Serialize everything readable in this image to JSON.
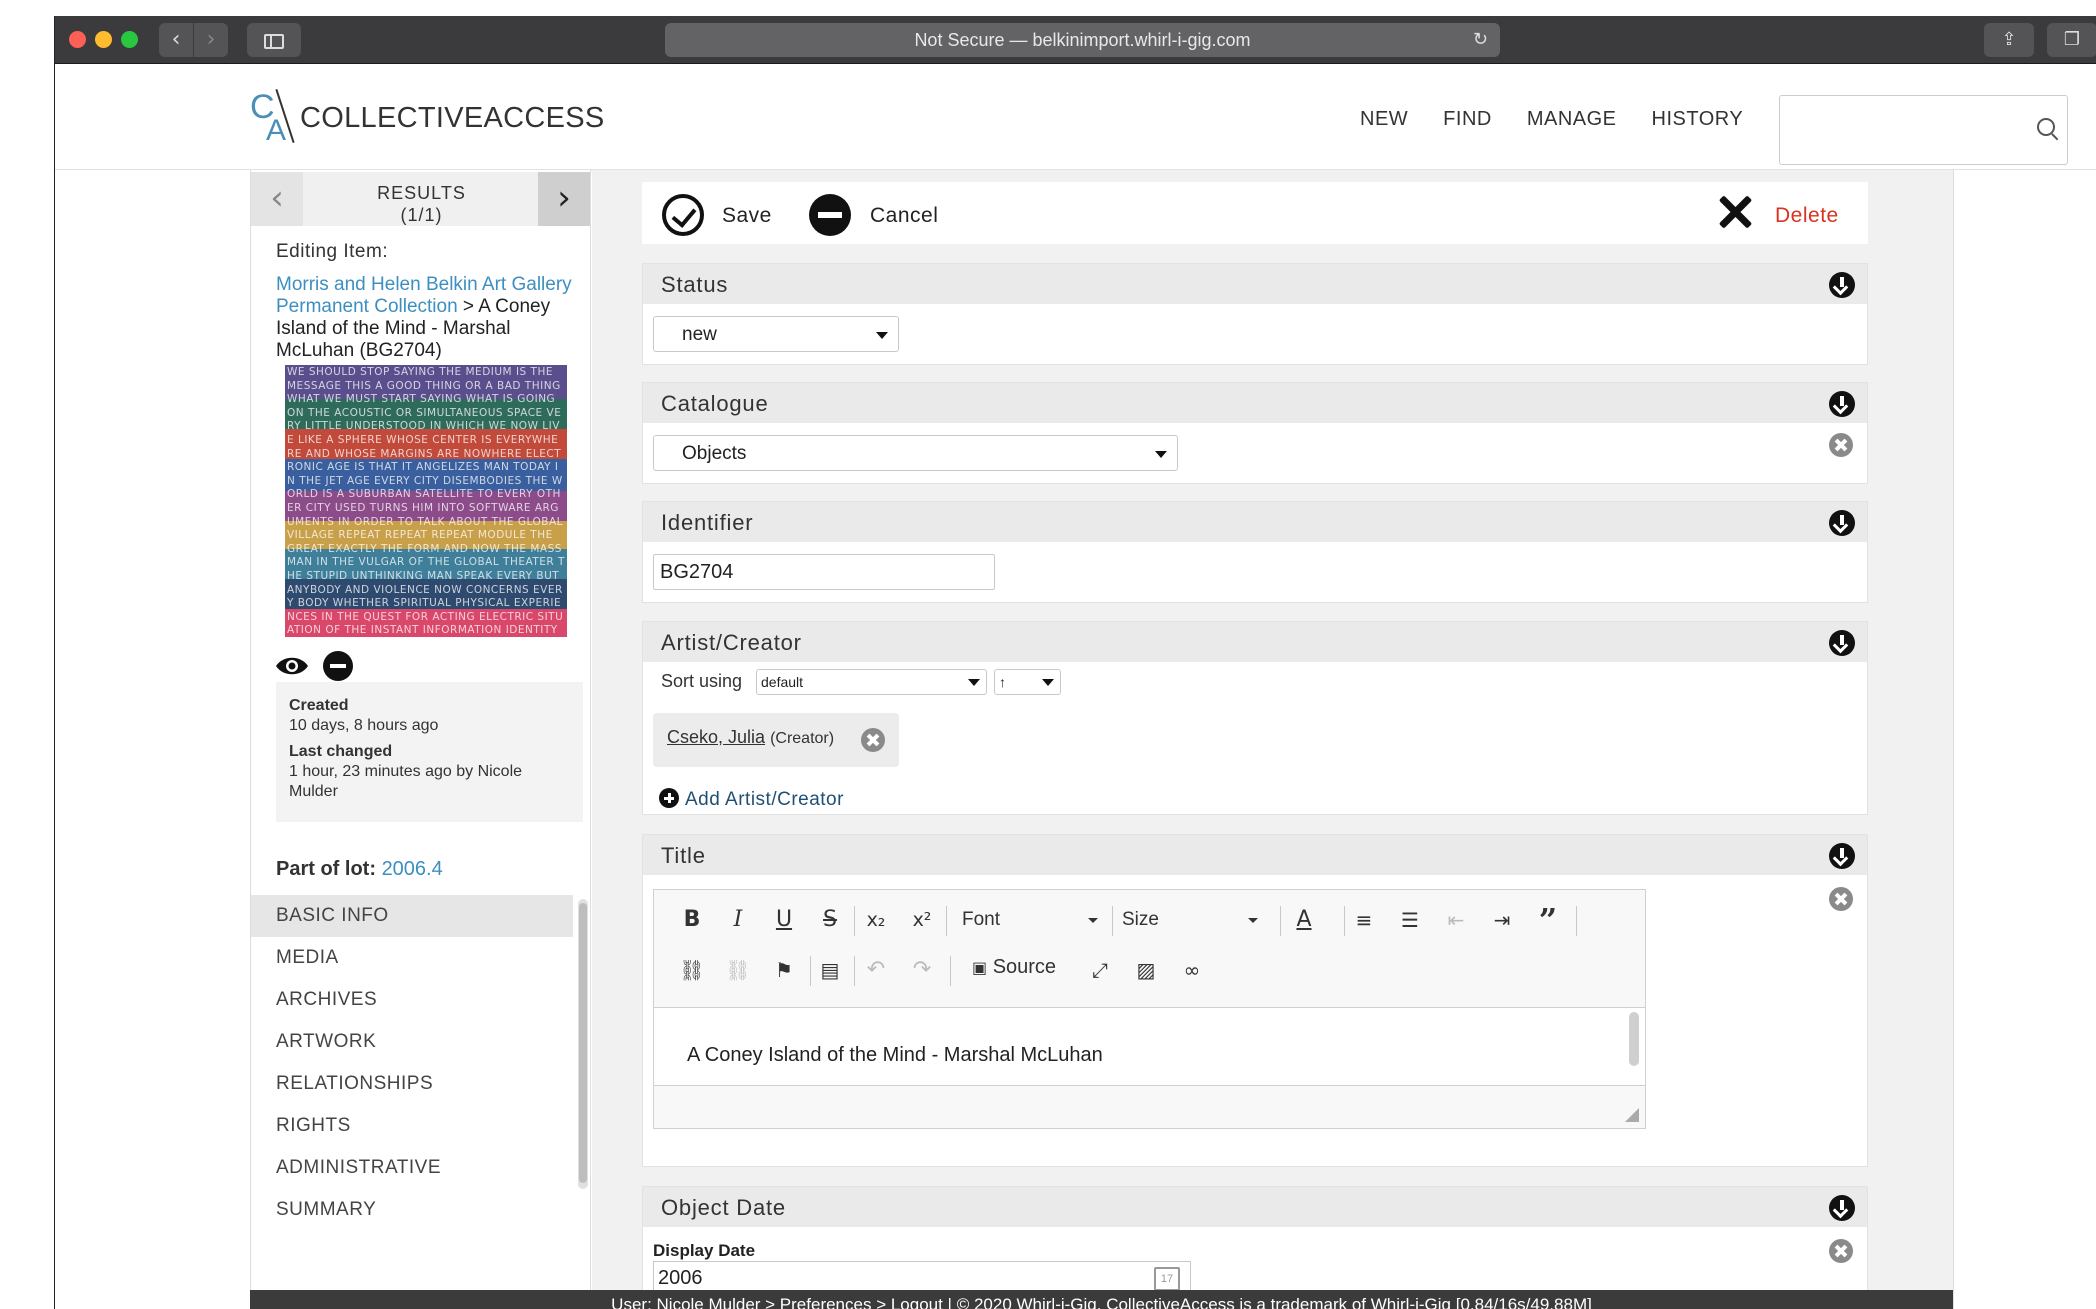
{
  "browser": {
    "url_text": "Not Secure — belkinimport.whirl-i-gig.com",
    "back_icon": "‹",
    "forward_icon": "›"
  },
  "header": {
    "logo_text": "COLLECTIVEACCESS",
    "logo_c": "C",
    "logo_a": "A",
    "nav": [
      "NEW",
      "FIND",
      "MANAGE",
      "HISTORY"
    ],
    "search_placeholder": ""
  },
  "sidebar": {
    "results_label": "RESULTS",
    "results_count": "(1/1)",
    "prev_icon": "‹",
    "next_icon": "›",
    "editing_label": "Editing Item:",
    "collection_link": "Morris and Helen Belkin Art Gallery Permanent Collection",
    "path_separator": " > ",
    "item_title": "A Coney Island of the Mind - Marshal McLuhan (BG2704)",
    "thumbnail_text": "WE SHOULD STOP SAYING THE MEDIUM IS THE MESSAGE THIS A GOOD THING OR A BAD THING WHAT WE MUST START SAYING WHAT IS GOING ON THE ACOUSTIC OR SIMULTANEOUS SPACE VERY LITTLE UNDERSTOOD IN WHICH WE NOW LIVE LIKE A SPHERE WHOSE CENTER IS EVERYWHERE AND WHOSE MARGINS ARE NOWHERE ELECTRONIC AGE IS THAT IT ANGELIZES MAN TODAY IN THE JET AGE EVERY CITY DISEMBODIES THE WORLD IS A SUBURBAN SATELLITE TO EVERY OTHER CITY USED TURNS HIM INTO SOFTWARE ARGUMENTS IN ORDER TO TALK ABOUT THE GLOBAL VILLAGE REPEAT REPEAT REPEAT MODULE THE GREAT EXACTLY THE FORM AND NOW THE MASS MAN IN THE VULGAR OF THE GLOBAL THEATER THE STUPID UNTHINKING MAN SPEAK EVERY BUT ANYBODY AND VIOLENCE NOW CONCERNS EVERY BODY WHETHER SPIRITUAL PHYSICAL EXPERIENCES IN THE QUEST FOR ACTING ELECTRIC SITUATION OF THE INSTANT INFORMATION IDENTITY MCLUHAN",
    "created_label": "Created",
    "created_value": "10 days, 8 hours ago",
    "changed_label": "Last changed",
    "changed_value": "1 hour, 23 minutes ago by Nicole Mulder",
    "lot_label": "Part of lot:",
    "lot_value": "2006.4",
    "sections": [
      "BASIC INFO",
      "MEDIA",
      "ARCHIVES",
      "ARTWORK",
      "RELATIONSHIPS",
      "RIGHTS",
      "ADMINISTRATIVE",
      "SUMMARY"
    ],
    "active_section": "BASIC INFO"
  },
  "toolbar": {
    "save_label": "Save",
    "cancel_label": "Cancel",
    "delete_label": "Delete"
  },
  "form": {
    "status": {
      "title": "Status",
      "value": "new"
    },
    "catalogue": {
      "title": "Catalogue",
      "value": "Objects"
    },
    "identifier": {
      "title": "Identifier",
      "value": "BG2704"
    },
    "artist": {
      "title": "Artist/Creator",
      "sort_label": "Sort using",
      "sort_value": "default",
      "sort_dir": "↑",
      "entity_name": "Cseko, Julia",
      "entity_role": "(Creator)",
      "add_label": "Add Artist/Creator"
    },
    "title_field": {
      "title": "Title",
      "font_label": "Font",
      "size_label": "Size",
      "source_label": "Source",
      "value": "A Coney Island of the Mind - Marshal McLuhan"
    },
    "object_date": {
      "title": "Object Date",
      "display_label": "Display Date",
      "display_value": "2006",
      "calendar_day": "17"
    }
  },
  "footer": {
    "text": "User: Nicole Mulder > Preferences > Logout | © 2020 Whirl-i-Gig. CollectiveAccess is a trademark of Whirl-i-Gig [0.84/16s/49.88M]"
  },
  "colors": {
    "accent_link": "#3d8fc0",
    "delete_red": "#d9331f",
    "panel_bg": "#f1f1f1",
    "bundle_head_bg": "#eaeaea"
  }
}
